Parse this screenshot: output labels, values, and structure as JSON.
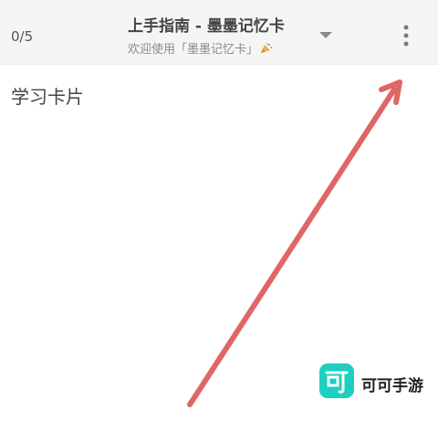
{
  "header": {
    "counter": "0/5",
    "title": "上手指南 - 墨墨记忆卡",
    "subtitle": "欢迎使用「墨墨记忆卡」",
    "subtitle_icon": "party-popper-icon",
    "dropdown_icon": "caret-down-icon",
    "more_icon": "more-vertical-icon"
  },
  "content": {
    "card_label": "学习卡片"
  },
  "annotation": {
    "arrow_color": "#e06666"
  },
  "watermark": {
    "text": "可可手游",
    "logo_color": "#1dcfc0"
  }
}
